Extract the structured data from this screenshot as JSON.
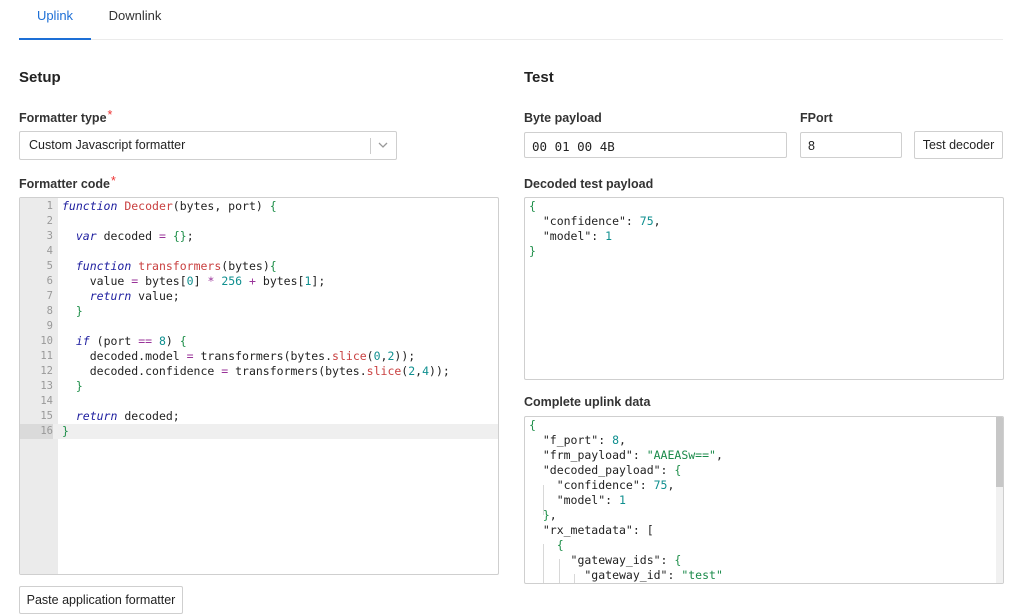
{
  "tabs": [
    {
      "label": "Uplink",
      "active": true
    },
    {
      "label": "Downlink",
      "active": false
    }
  ],
  "setup": {
    "title": "Setup",
    "formatter_type_label": "Formatter type",
    "formatter_type_value": "Custom Javascript formatter",
    "formatter_code_label": "Formatter code",
    "required_mark": "*",
    "paste_button_label": "Paste application formatter",
    "code_lines": [
      "function Decoder(bytes, port) {",
      "",
      "  var decoded = {};",
      "",
      "  function transformers(bytes){",
      "    value = bytes[0] * 256 + bytes[1];",
      "    return value;",
      "  }",
      "",
      "  if (port == 8) {",
      "    decoded.model = transformers(bytes.slice(0,2));",
      "    decoded.confidence = transformers(bytes.slice(2,4));",
      "  }",
      "",
      "  return decoded;",
      "}"
    ]
  },
  "test": {
    "title": "Test",
    "byte_payload_label": "Byte payload",
    "byte_payload_value": "00 01 00 4B",
    "fport_label": "FPort",
    "fport_value": "8",
    "test_decoder_label": "Test decoder",
    "decoded_label": "Decoded test payload",
    "decoded_lines": [
      "{",
      "  \"confidence\": 75,",
      "  \"model\": 1",
      "}"
    ],
    "uplink_label": "Complete uplink data",
    "uplink_lines": [
      "{",
      "  \"f_port\": 8,",
      "  \"frm_payload\": \"AAEASw==\",",
      "  \"decoded_payload\": {",
      "    \"confidence\": 75,",
      "    \"model\": 1",
      "  },",
      "  \"rx_metadata\": [",
      "    {",
      "      \"gateway_ids\": {",
      "        \"gateway_id\": \"test\""
    ]
  },
  "colors": {
    "accent": "#1d6fd6",
    "required": "#ee3333",
    "keyword": "#2020a0",
    "function_name": "#c94040",
    "number": "#0f8f8f",
    "string": "#1a8a4a"
  }
}
